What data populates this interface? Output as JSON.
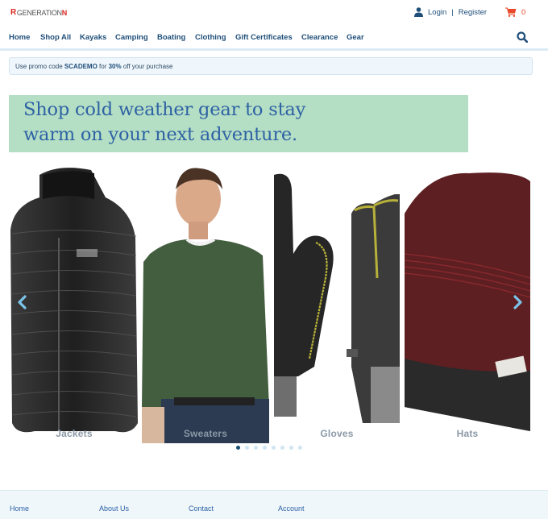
{
  "header": {
    "logo": {
      "mark": "R",
      "text": "GENERATION",
      "accent": "N"
    },
    "login_label": "Login",
    "separator": "|",
    "register_label": "Register",
    "cart_count": "0"
  },
  "nav": {
    "items": [
      {
        "label": "Home"
      },
      {
        "label": "Shop All"
      },
      {
        "label": "Kayaks"
      },
      {
        "label": "Camping"
      },
      {
        "label": "Boating"
      },
      {
        "label": "Clothing"
      },
      {
        "label": "Gift Certificates"
      },
      {
        "label": "Clearance"
      },
      {
        "label": "Gear"
      }
    ],
    "search_icon": "search-icon"
  },
  "promo": {
    "prefix": "Use promo code ",
    "code": "SCADEMO",
    "middle": " for ",
    "discount": "30%",
    "suffix": " off your purchase"
  },
  "hero": {
    "line1": "Shop cold weather gear to stay",
    "line2": "warm on your next adventure."
  },
  "carousel": {
    "slides": [
      {
        "label": "Jackets"
      },
      {
        "label": "Sweaters"
      },
      {
        "label": "Gloves"
      },
      {
        "label": "Hats"
      }
    ],
    "dot_count": 8,
    "active_dot": 0,
    "prev_icon": "chevron-left-icon",
    "next_icon": "chevron-right-icon"
  },
  "footer": {
    "links": [
      {
        "label": "Home"
      },
      {
        "label": "About Us"
      },
      {
        "label": "Contact"
      },
      {
        "label": "Account"
      }
    ]
  },
  "colors": {
    "brand_blue": "#1f4e79",
    "logo_red": "#d9251d",
    "cart_orange": "#e8492a",
    "hero_bg": "#b5dfc4",
    "hero_text": "#2e62a4",
    "arrow": "#7cc4ea"
  }
}
